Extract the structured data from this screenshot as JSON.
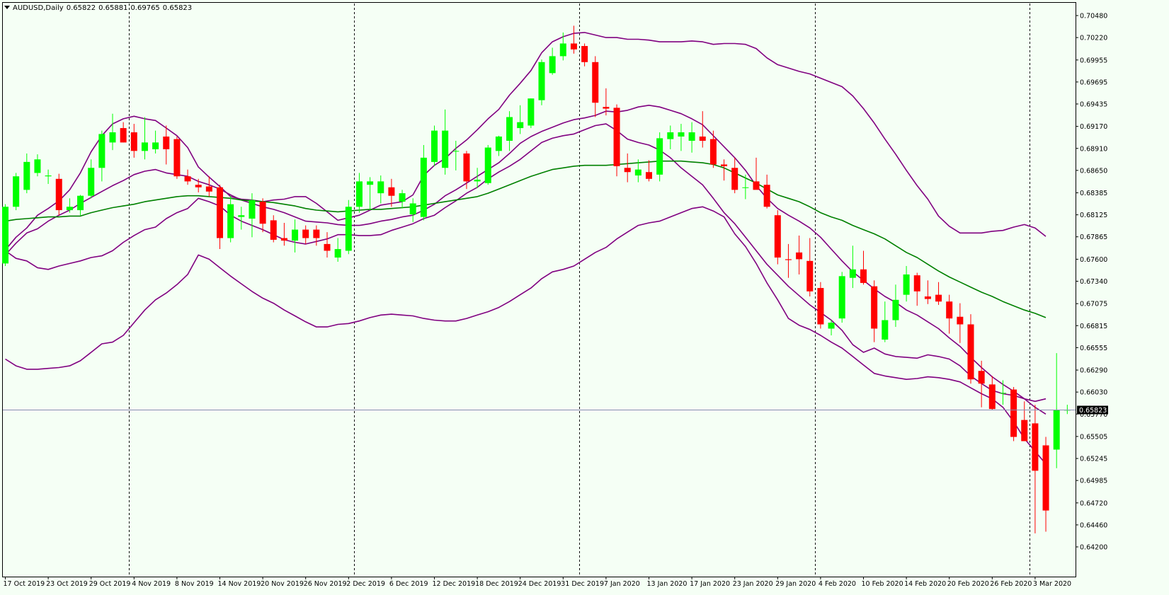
{
  "chart_data": {
    "type": "candlestick",
    "symbol": "AUDUSD,Daily",
    "ohlc_header": [
      "0.65822",
      "0.65881",
      "0.69765",
      "0.65823"
    ],
    "current_price": "0.65823",
    "ylim": [
      0.642,
      0.706
    ],
    "y_ticks": [
      "0.70480",
      "0.70220",
      "0.69955",
      "0.69695",
      "0.69435",
      "0.69170",
      "0.68910",
      "0.68650",
      "0.68385",
      "0.68125",
      "0.67865",
      "0.67600",
      "0.67340",
      "0.67075",
      "0.66815",
      "0.66555",
      "0.66290",
      "0.66030",
      "0.65770",
      "0.65505",
      "0.65245",
      "0.64985",
      "0.64720",
      "0.64460",
      "0.64200"
    ],
    "x_labels": [
      {
        "label": "17 Oct 2019",
        "bar": 0
      },
      {
        "label": "23 Oct 2019",
        "bar": 4
      },
      {
        "label": "29 Oct 2019",
        "bar": 8
      },
      {
        "label": "4 Nov 2019",
        "bar": 12
      },
      {
        "label": "8 Nov 2019",
        "bar": 16
      },
      {
        "label": "14 Nov 2019",
        "bar": 20
      },
      {
        "label": "20 Nov 2019",
        "bar": 24
      },
      {
        "label": "26 Nov 2019",
        "bar": 28
      },
      {
        "label": "2 Dec 2019",
        "bar": 32
      },
      {
        "label": "6 Dec 2019",
        "bar": 36
      },
      {
        "label": "12 Dec 2019",
        "bar": 40
      },
      {
        "label": "18 Dec 2019",
        "bar": 44
      },
      {
        "label": "24 Dec 2019",
        "bar": 48
      },
      {
        "label": "31 Dec 2019",
        "bar": 52
      },
      {
        "label": "7 Jan 2020",
        "bar": 56
      },
      {
        "label": "13 Jan 2020",
        "bar": 60
      },
      {
        "label": "17 Jan 2020",
        "bar": 64
      },
      {
        "label": "23 Jan 2020",
        "bar": 68
      },
      {
        "label": "29 Jan 2020",
        "bar": 72
      },
      {
        "label": "4 Feb 2020",
        "bar": 76
      },
      {
        "label": "10 Feb 2020",
        "bar": 80
      },
      {
        "label": "14 Feb 2020",
        "bar": 84
      },
      {
        "label": "20 Feb 2020",
        "bar": 88
      },
      {
        "label": "26 Feb 2020",
        "bar": 92
      },
      {
        "label": "3 Mar 2020",
        "bar": 96
      }
    ],
    "period_separators": [
      11,
      32,
      53,
      75,
      95
    ],
    "candles": [
      [
        0.6755,
        0.6825,
        0.6752,
        0.6822
      ],
      [
        0.6822,
        0.6862,
        0.6818,
        0.6858
      ],
      [
        0.6842,
        0.6885,
        0.6838,
        0.6875
      ],
      [
        0.6862,
        0.6884,
        0.6858,
        0.6878
      ],
      [
        0.6858,
        0.6866,
        0.6849,
        0.6859
      ],
      [
        0.6855,
        0.6861,
        0.6812,
        0.6818
      ],
      [
        0.6818,
        0.6832,
        0.6815,
        0.6822
      ],
      [
        0.6818,
        0.6836,
        0.6812,
        0.6835
      ],
      [
        0.6835,
        0.6878,
        0.6832,
        0.6868
      ],
      [
        0.6868,
        0.6912,
        0.6852,
        0.6908
      ],
      [
        0.6898,
        0.6932,
        0.6889,
        0.691
      ],
      [
        0.6915,
        0.6922,
        0.6898,
        0.6898
      ],
      [
        0.691,
        0.692,
        0.688,
        0.6888
      ],
      [
        0.6888,
        0.6928,
        0.6878,
        0.6898
      ],
      [
        0.689,
        0.6912,
        0.6885,
        0.6898
      ],
      [
        0.6905,
        0.6918,
        0.6872,
        0.689
      ],
      [
        0.6902,
        0.6905,
        0.6855,
        0.6858
      ],
      [
        0.6858,
        0.6866,
        0.6848,
        0.6852
      ],
      [
        0.6848,
        0.6855,
        0.6839,
        0.6845
      ],
      [
        0.6846,
        0.6858,
        0.6834,
        0.684
      ],
      [
        0.6845,
        0.6848,
        0.6772,
        0.6785
      ],
      [
        0.6785,
        0.6835,
        0.678,
        0.6825
      ],
      [
        0.681,
        0.6822,
        0.6795,
        0.6812
      ],
      [
        0.6808,
        0.6838,
        0.6786,
        0.683
      ],
      [
        0.6828,
        0.6832,
        0.6792,
        0.6802
      ],
      [
        0.6806,
        0.6812,
        0.678,
        0.6783
      ],
      [
        0.6785,
        0.6803,
        0.6776,
        0.6782
      ],
      [
        0.6782,
        0.6807,
        0.6768,
        0.6795
      ],
      [
        0.6795,
        0.68,
        0.6778,
        0.6785
      ],
      [
        0.6795,
        0.68,
        0.6776,
        0.6785
      ],
      [
        0.6778,
        0.6792,
        0.6762,
        0.677
      ],
      [
        0.6762,
        0.6785,
        0.6757,
        0.6772
      ],
      [
        0.677,
        0.683,
        0.6766,
        0.6822
      ],
      [
        0.6822,
        0.6862,
        0.6815,
        0.6852
      ],
      [
        0.6848,
        0.6857,
        0.6818,
        0.6852
      ],
      [
        0.6838,
        0.6859,
        0.6826,
        0.6852
      ],
      [
        0.6845,
        0.6855,
        0.6822,
        0.6835
      ],
      [
        0.6828,
        0.6842,
        0.682,
        0.6838
      ],
      [
        0.6813,
        0.6832,
        0.6804,
        0.6826
      ],
      [
        0.681,
        0.6895,
        0.6806,
        0.688
      ],
      [
        0.6875,
        0.6918,
        0.687,
        0.6912
      ],
      [
        0.6868,
        0.6937,
        0.686,
        0.6912
      ],
      [
        0.6888,
        0.69,
        0.6865,
        0.6888
      ],
      [
        0.6885,
        0.6888,
        0.6843,
        0.6852
      ],
      [
        0.6852,
        0.6868,
        0.6844,
        0.6854
      ],
      [
        0.685,
        0.6895,
        0.6848,
        0.6892
      ],
      [
        0.6888,
        0.6906,
        0.6882,
        0.6905
      ],
      [
        0.69,
        0.6935,
        0.6888,
        0.6928
      ],
      [
        0.6915,
        0.6942,
        0.6908,
        0.6922
      ],
      [
        0.6918,
        0.695,
        0.6915,
        0.695
      ],
      [
        0.6948,
        0.6996,
        0.6942,
        0.6993
      ],
      [
        0.698,
        0.701,
        0.6978,
        0.7
      ],
      [
        0.7,
        0.7028,
        0.6995,
        0.7015
      ],
      [
        0.7015,
        0.7036,
        0.7003,
        0.7008
      ],
      [
        0.7012,
        0.7015,
        0.6988,
        0.6993
      ],
      [
        0.6993,
        0.7,
        0.6928,
        0.6945
      ],
      [
        0.694,
        0.6962,
        0.693,
        0.6938
      ],
      [
        0.6939,
        0.6943,
        0.6858,
        0.687
      ],
      [
        0.6868,
        0.6885,
        0.6851,
        0.6863
      ],
      [
        0.6859,
        0.6878,
        0.6851,
        0.6866
      ],
      [
        0.6863,
        0.6877,
        0.6852,
        0.6855
      ],
      [
        0.686,
        0.691,
        0.6852,
        0.6903
      ],
      [
        0.6902,
        0.6918,
        0.689,
        0.691
      ],
      [
        0.6905,
        0.692,
        0.6888,
        0.691
      ],
      [
        0.69,
        0.6922,
        0.6886,
        0.691
      ],
      [
        0.6905,
        0.6935,
        0.6892,
        0.69
      ],
      [
        0.6902,
        0.6912,
        0.6868,
        0.6872
      ],
      [
        0.6872,
        0.6878,
        0.6853,
        0.687
      ],
      [
        0.6868,
        0.688,
        0.6838,
        0.6842
      ],
      [
        0.6845,
        0.686,
        0.6831,
        0.6845
      ],
      [
        0.6852,
        0.688,
        0.6848,
        0.6842
      ],
      [
        0.6848,
        0.686,
        0.682,
        0.6822
      ],
      [
        0.6812,
        0.6818,
        0.6754,
        0.6762
      ],
      [
        0.676,
        0.6778,
        0.6738,
        0.6759
      ],
      [
        0.6768,
        0.6788,
        0.6742,
        0.676
      ],
      [
        0.6758,
        0.6785,
        0.6716,
        0.6722
      ],
      [
        0.6726,
        0.6733,
        0.6678,
        0.6683
      ],
      [
        0.6678,
        0.6688,
        0.667,
        0.6685
      ],
      [
        0.669,
        0.6745,
        0.6685,
        0.674
      ],
      [
        0.6738,
        0.6776,
        0.6726,
        0.6748
      ],
      [
        0.6748,
        0.677,
        0.673,
        0.6732
      ],
      [
        0.6728,
        0.6735,
        0.6662,
        0.6678
      ],
      [
        0.6665,
        0.671,
        0.6662,
        0.6688
      ],
      [
        0.6688,
        0.673,
        0.668,
        0.6712
      ],
      [
        0.6718,
        0.6752,
        0.671,
        0.6742
      ],
      [
        0.6741,
        0.6744,
        0.6705,
        0.6722
      ],
      [
        0.6716,
        0.6735,
        0.6707,
        0.6713
      ],
      [
        0.6718,
        0.6733,
        0.6706,
        0.671
      ],
      [
        0.671,
        0.6718,
        0.6672,
        0.669
      ],
      [
        0.6692,
        0.6708,
        0.6661,
        0.6683
      ],
      [
        0.6683,
        0.6695,
        0.6613,
        0.6618
      ],
      [
        0.6628,
        0.664,
        0.6585,
        0.6613
      ],
      [
        0.6612,
        0.6622,
        0.6582,
        0.6583
      ],
      [
        0.6602,
        0.6617,
        0.6588,
        0.6602
      ],
      [
        0.6606,
        0.6609,
        0.6545,
        0.655
      ],
      [
        0.657,
        0.6592,
        0.6548,
        0.6545
      ],
      [
        0.6566,
        0.6588,
        0.6436,
        0.651
      ],
      [
        0.654,
        0.655,
        0.6438,
        0.6463
      ],
      [
        0.6535,
        0.6649,
        0.6513,
        0.6582
      ],
      [
        0.6582,
        0.6588,
        0.6577,
        0.6582
      ]
    ],
    "indicators": [
      {
        "color": "#800080",
        "values": [
          0.6771,
          0.6786,
          0.6797,
          0.6812,
          0.682,
          0.6829,
          0.6842,
          0.6862,
          0.6887,
          0.6906,
          0.692,
          0.6926,
          0.6929,
          0.6926,
          0.6924,
          0.6915,
          0.6906,
          0.6892,
          0.6869,
          0.6857,
          0.6846,
          0.6834,
          0.6831,
          0.683,
          0.6828,
          0.683,
          0.6831,
          0.6834,
          0.6834,
          0.6826,
          0.6816,
          0.6806,
          0.6809,
          0.6812,
          0.6818,
          0.6824,
          0.6826,
          0.6828,
          0.6836,
          0.6859,
          0.6871,
          0.6879,
          0.6891,
          0.6901,
          0.6913,
          0.6926,
          0.6937,
          0.6954,
          0.6968,
          0.6983,
          0.7004,
          0.7017,
          0.7023,
          0.7027,
          0.7028,
          0.7025,
          0.7022,
          0.7022,
          0.702,
          0.702,
          0.7019,
          0.7017,
          0.7017,
          0.7017,
          0.7018,
          0.7017,
          0.7014,
          0.7015,
          0.7015,
          0.7014,
          0.7009,
          0.6998,
          0.699,
          0.6986,
          0.6982,
          0.6979,
          0.6974,
          0.6969,
          0.6964,
          0.6953,
          0.6938,
          0.6921,
          0.6902,
          0.6884,
          0.6865,
          0.6847,
          0.6831,
          0.6811,
          0.6799,
          0.6791,
          0.6791,
          0.6791,
          0.6793,
          0.6794,
          0.6798,
          0.6801,
          0.6797,
          0.6787
        ]
      },
      {
        "color": "#800080",
        "values": [
          0.6765,
          0.6779,
          0.6791,
          0.6796,
          0.6805,
          0.6812,
          0.6818,
          0.6826,
          0.6833,
          0.684,
          0.6847,
          0.6853,
          0.686,
          0.6864,
          0.6866,
          0.6862,
          0.686,
          0.6858,
          0.6852,
          0.6848,
          0.6843,
          0.6836,
          0.683,
          0.6826,
          0.6822,
          0.6819,
          0.6815,
          0.681,
          0.6805,
          0.6804,
          0.6803,
          0.6801,
          0.68,
          0.68,
          0.6802,
          0.6805,
          0.6807,
          0.681,
          0.6812,
          0.6818,
          0.6825,
          0.6835,
          0.6842,
          0.685,
          0.6858,
          0.6866,
          0.6874,
          0.6885,
          0.6897,
          0.6905,
          0.6911,
          0.6916,
          0.6921,
          0.6925,
          0.6927,
          0.693,
          0.6935,
          0.6934,
          0.6936,
          0.694,
          0.6942,
          0.694,
          0.6936,
          0.6932,
          0.6926,
          0.6919,
          0.6906,
          0.6893,
          0.688,
          0.6865,
          0.6847,
          0.6832,
          0.682,
          0.6812,
          0.6805,
          0.6797,
          0.6786,
          0.6772,
          0.6758,
          0.6745,
          0.6735,
          0.6725,
          0.6716,
          0.6709,
          0.67,
          0.6694,
          0.6686,
          0.6678,
          0.6667,
          0.6657,
          0.6644,
          0.6632,
          0.6621,
          0.6612,
          0.6604,
          0.6595,
          0.6585,
          0.6577
        ]
      },
      {
        "color": "#800080",
        "values": [
          0.677,
          0.6761,
          0.6758,
          0.675,
          0.6748,
          0.6752,
          0.6755,
          0.6758,
          0.6762,
          0.6764,
          0.677,
          0.678,
          0.6788,
          0.6795,
          0.6798,
          0.6808,
          0.6815,
          0.682,
          0.6832,
          0.6828,
          0.6823,
          0.6812,
          0.6805,
          0.68,
          0.6795,
          0.6789,
          0.6783,
          0.678,
          0.6778,
          0.6781,
          0.6784,
          0.6789,
          0.6789,
          0.6788,
          0.6788,
          0.6789,
          0.6794,
          0.6798,
          0.6802,
          0.6808,
          0.6812,
          0.6821,
          0.6829,
          0.6838,
          0.6845,
          0.6855,
          0.6863,
          0.687,
          0.6878,
          0.6888,
          0.6898,
          0.6903,
          0.6906,
          0.6908,
          0.6913,
          0.6918,
          0.692,
          0.6912,
          0.6902,
          0.6898,
          0.6895,
          0.6889,
          0.688,
          0.6868,
          0.6858,
          0.6848,
          0.6832,
          0.6815,
          0.6802,
          0.6786,
          0.677,
          0.6754,
          0.6741,
          0.6728,
          0.6717,
          0.6706,
          0.6697,
          0.6688,
          0.6676,
          0.6659,
          0.665,
          0.6655,
          0.6648,
          0.6645,
          0.6644,
          0.6643,
          0.6647,
          0.6645,
          0.6642,
          0.6634,
          0.6622,
          0.6613,
          0.6605,
          0.6601,
          0.6599,
          0.6595,
          0.6592,
          0.6595
        ]
      },
      {
        "color": "#800080",
        "values": [
          0.6642,
          0.6634,
          0.663,
          0.663,
          0.6631,
          0.6632,
          0.6634,
          0.664,
          0.665,
          0.666,
          0.6662,
          0.667,
          0.6685,
          0.67,
          0.6712,
          0.672,
          0.673,
          0.6742,
          0.6765,
          0.676,
          0.675,
          0.674,
          0.6731,
          0.6722,
          0.6714,
          0.6708,
          0.67,
          0.6693,
          0.6686,
          0.668,
          0.668,
          0.6683,
          0.6684,
          0.6687,
          0.6691,
          0.6694,
          0.6695,
          0.6694,
          0.6693,
          0.669,
          0.6688,
          0.6687,
          0.6687,
          0.669,
          0.6694,
          0.6698,
          0.6703,
          0.671,
          0.6718,
          0.6726,
          0.6737,
          0.6745,
          0.6748,
          0.6752,
          0.676,
          0.6768,
          0.6774,
          0.6784,
          0.6792,
          0.68,
          0.6803,
          0.6805,
          0.681,
          0.6815,
          0.682,
          0.6822,
          0.6817,
          0.681,
          0.679,
          0.6775,
          0.6755,
          0.6732,
          0.6712,
          0.669,
          0.6682,
          0.6677,
          0.667,
          0.6662,
          0.6655,
          0.6645,
          0.6635,
          0.6625,
          0.6622,
          0.662,
          0.6618,
          0.6619,
          0.6621,
          0.662,
          0.6618,
          0.6615,
          0.6608,
          0.6601,
          0.6595,
          0.6585,
          0.6568,
          0.6548,
          0.6533,
          0.6518
        ]
      },
      {
        "color": "#008000",
        "values": [
          0.6805,
          0.6807,
          0.6808,
          0.6809,
          0.681,
          0.681,
          0.6811,
          0.6811,
          0.6815,
          0.6818,
          0.6821,
          0.6823,
          0.6825,
          0.6828,
          0.683,
          0.6832,
          0.6834,
          0.6835,
          0.6835,
          0.6834,
          0.6833,
          0.6832,
          0.683,
          0.6829,
          0.6828,
          0.6827,
          0.6825,
          0.6823,
          0.682,
          0.6818,
          0.6817,
          0.6816,
          0.6817,
          0.6818,
          0.6819,
          0.6819,
          0.682,
          0.6821,
          0.6822,
          0.6824,
          0.6826,
          0.6828,
          0.683,
          0.6832,
          0.6834,
          0.6838,
          0.6843,
          0.6848,
          0.6853,
          0.6858,
          0.6862,
          0.6866,
          0.6868,
          0.687,
          0.6871,
          0.6871,
          0.6871,
          0.6872,
          0.6873,
          0.6874,
          0.6875,
          0.6876,
          0.6876,
          0.6876,
          0.6875,
          0.6874,
          0.6872,
          0.6868,
          0.6862,
          0.6856,
          0.685,
          0.6843,
          0.6836,
          0.6832,
          0.6828,
          0.6822,
          0.6815,
          0.681,
          0.6806,
          0.68,
          0.6795,
          0.679,
          0.6784,
          0.6776,
          0.6768,
          0.6762,
          0.6754,
          0.6746,
          0.6739,
          0.6733,
          0.6727,
          0.6721,
          0.6716,
          0.671,
          0.6705,
          0.67,
          0.6696,
          0.6691
        ]
      }
    ]
  }
}
